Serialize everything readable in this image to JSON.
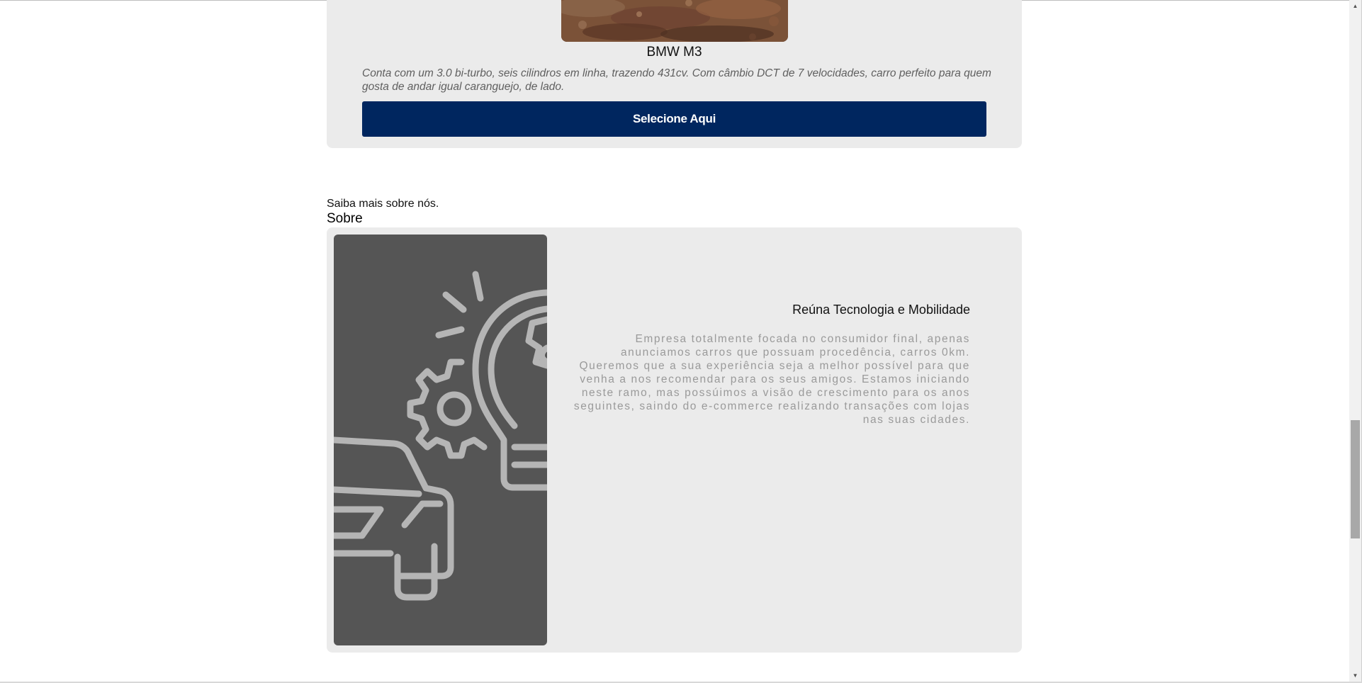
{
  "car": {
    "title": "BMW M3",
    "description": "Conta com um 3.0 bi-turbo, seis cilindros em linha, trazendo 431cv. Com câmbio DCT de 7 velocidades, carro perfeito para quem gosta de andar igual caranguejo, de lado.",
    "button_label": "Selecione Aqui",
    "photo": "car-photo"
  },
  "about": {
    "subtitle": "Saiba mais sobre nós.",
    "title": "Sobre",
    "heading": "Reúna Tecnologia e Mobilidade",
    "text": "Empresa totalmente focada no consumidor final, apenas anunciamos carros que possuam procedência, carros 0km. Queremos que a sua experiência seja a melhor possível para que venha a nos recomendar para os seus amigos. Estamos iniciando neste ramo, mas possúimos a visão de crescimento para os anos seguintes, saindo do e-commerce realizando transações com lojas nas suas cidades.",
    "illustration": "car-lightbulb-gear-illustration"
  },
  "colors": {
    "button_bg": "#00265f",
    "card_bg": "#ebebeb",
    "illustration_bg": "#555555",
    "illustration_stroke": "#b5b5b5"
  },
  "scrollbar": {
    "position_fraction": 0.62
  }
}
